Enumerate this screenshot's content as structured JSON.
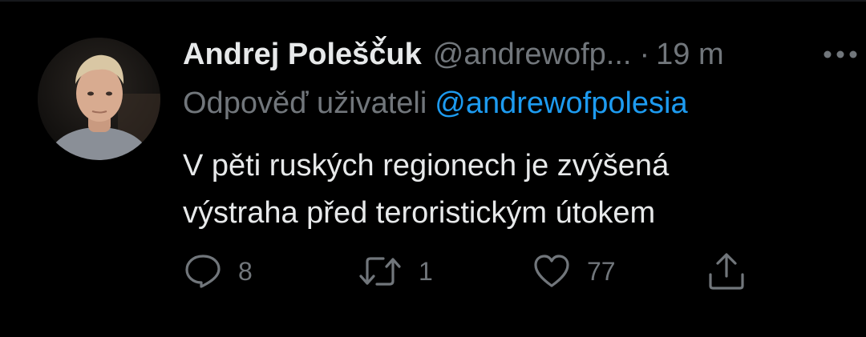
{
  "tweet": {
    "author_name": "Andrej Polešč̌uk",
    "handle": "@andrewofp...",
    "separator": "·",
    "time": "19 m",
    "reply_prefix": "Odpověď uživateli",
    "reply_to": "@andrewofpolesia",
    "text_lines": [
      "V pěti ruských regionech je zvýšená",
      "výstraha před teroristickým útokem"
    ]
  },
  "actions": {
    "reply": {
      "icon": "reply-icon",
      "count": "8"
    },
    "retweet": {
      "icon": "retweet-icon",
      "count": "1"
    },
    "like": {
      "icon": "heart-icon",
      "count": "77"
    },
    "share": {
      "icon": "share-icon"
    }
  },
  "more": {
    "icon": "more-dots-icon"
  },
  "colors": {
    "background": "#000000",
    "primary_text": "#e7e9ea",
    "secondary_text": "#71767b",
    "link": "#1d9bf0"
  }
}
